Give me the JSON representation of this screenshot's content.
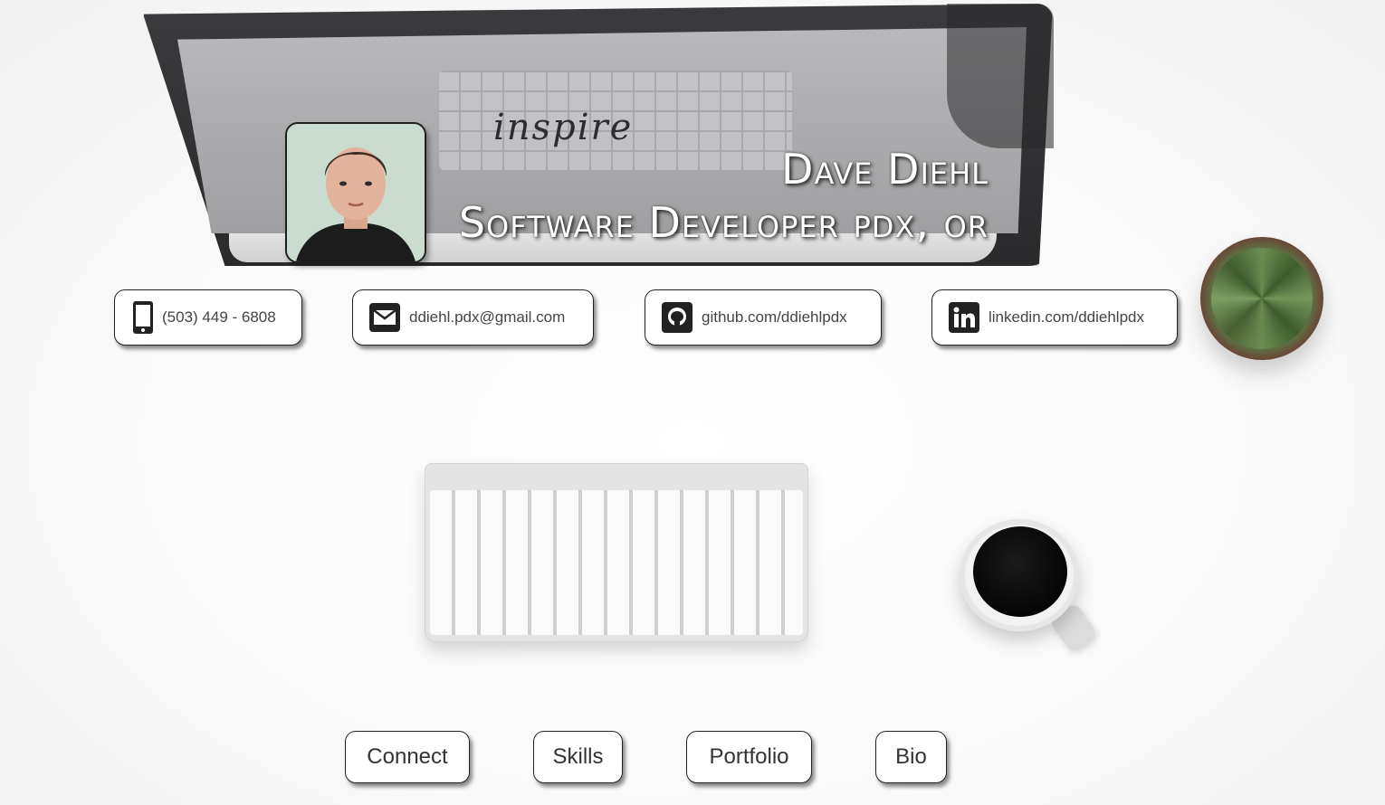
{
  "header": {
    "name": "Dave Diehl",
    "title": "Software Developer pdx, or"
  },
  "background": {
    "screen_word": "inspire"
  },
  "contacts": [
    {
      "icon": "phone-icon",
      "label": "(503) 449 - 6808"
    },
    {
      "icon": "email-icon",
      "label": "ddiehl.pdx@gmail.com"
    },
    {
      "icon": "github-icon",
      "label": "github.com/ddiehlpdx"
    },
    {
      "icon": "linkedin-icon",
      "label": "linkedin.com/ddiehlpdx"
    }
  ],
  "nav": [
    {
      "label": "Connect"
    },
    {
      "label": "Skills"
    },
    {
      "label": "Portfolio"
    },
    {
      "label": "Bio"
    }
  ],
  "colors": {
    "background": "#f7f7f7",
    "button_bg": "#ffffff",
    "button_border": "#222222",
    "icon": "#222222",
    "header_text": "#ffffff"
  }
}
